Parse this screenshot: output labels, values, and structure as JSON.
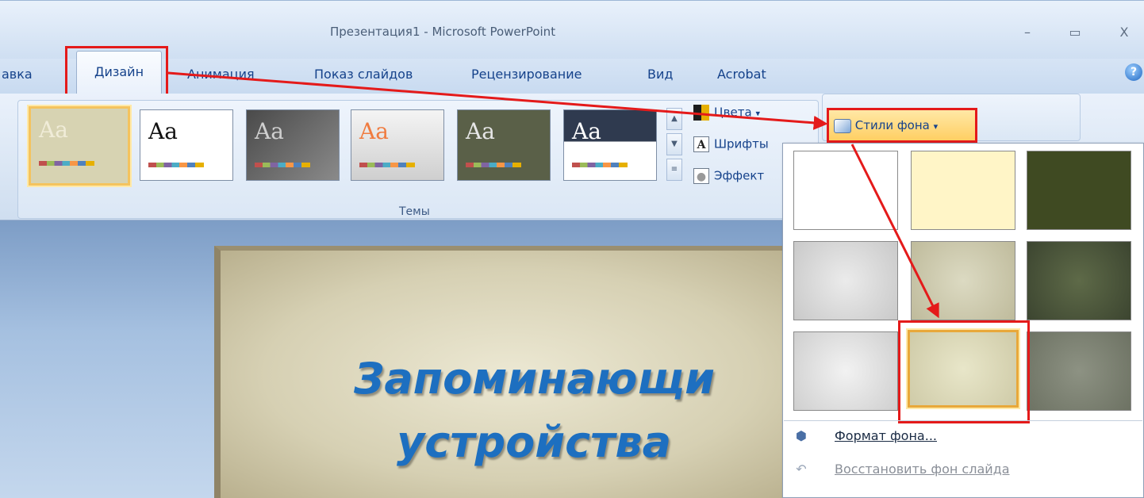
{
  "window": {
    "title": "Презентация1 - Microsoft PowerPoint",
    "minimize": "–",
    "maximize": "▭",
    "close": "X"
  },
  "tabs": [
    {
      "label": "авка"
    },
    {
      "label": "Дизайн"
    },
    {
      "label": "Анимация"
    },
    {
      "label": "Показ слайдов"
    },
    {
      "label": "Рецензирование"
    },
    {
      "label": "Вид"
    },
    {
      "label": "Acrobat"
    }
  ],
  "help_icon": "?",
  "ribbon": {
    "themes_group_label": "Темы",
    "themes": [
      {
        "aa": "Aa",
        "bg": "#d7d3b2",
        "fg": "#f0ecd8"
      },
      {
        "aa": "Aa",
        "bg": "#ffffff",
        "fg": "#111111"
      },
      {
        "aa": "Aa",
        "bg": "#6b6b6b",
        "fg": "#cfcfcf"
      },
      {
        "aa": "Aa",
        "bg": "#f4f4f4",
        "fg": "#f07b3f"
      },
      {
        "aa": "Aa",
        "bg": "#5a6048",
        "fg": "#e6e6e6"
      },
      {
        "aa": "Aa",
        "bg": "#2f3a4f",
        "fg": "#ffffff"
      }
    ],
    "colors_label": "Цвета",
    "fonts_label": "Шрифты",
    "effects_label": "Эффект",
    "font_glyph": "A",
    "bg_styles_label": "Стили фона",
    "dropdown_caret": "▾"
  },
  "slide": {
    "title_line1": "Запоминающи",
    "title_line2": "устройства"
  },
  "dropdown": {
    "swatches": [
      {
        "color": "#ffffff"
      },
      {
        "color": "#fff5c7"
      },
      {
        "color": "#3f4a22"
      },
      {
        "color": "#dadada"
      },
      {
        "color": "#cfcdb2"
      },
      {
        "color": "#4b5638"
      },
      {
        "color": "#e4e4e4"
      },
      {
        "color": "#dedbbd"
      },
      {
        "color": "#7f8475"
      }
    ],
    "format_bg": "Формат фона...",
    "reset_bg": "Восстановить фон слайда"
  },
  "accent_colors": {
    "highlight": "#e41a1a",
    "tab_text": "#15428b",
    "slide_title": "#1d6fc0"
  }
}
